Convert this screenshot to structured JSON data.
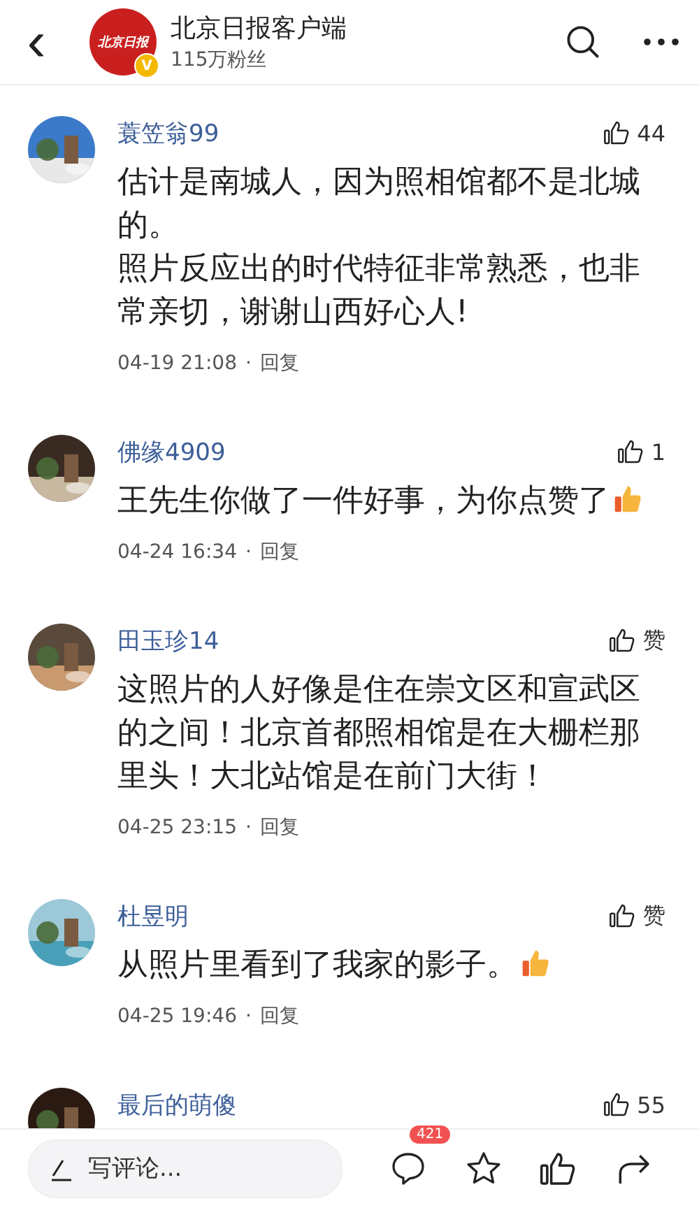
{
  "header": {
    "back": "‹",
    "logo_text": "北京日报",
    "verified": "V",
    "title": "北京日报客户端",
    "subtitle": "115万粉丝"
  },
  "comments": [
    {
      "name": "蓑笠翁99",
      "likes": "44",
      "paragraphs": [
        "估计是南城人，因为照相馆都不是北城的。",
        "照片反应出的时代特征非常熟悉，也非常亲切，谢谢山西好心人!"
      ],
      "emoji": false,
      "time": "04-19 21:08",
      "reply": "回复"
    },
    {
      "name": "佛缘4909",
      "likes": "1",
      "paragraphs": [
        "王先生你做了一件好事，为你点赞了"
      ],
      "emoji": true,
      "time": "04-24 16:34",
      "reply": "回复"
    },
    {
      "name": "田玉珍14",
      "likes": "赞",
      "paragraphs": [
        "这照片的人好像是住在崇文区和宣武区的之间！北京首都照相馆是在大栅栏那里头！大北站馆是在前门大街！"
      ],
      "emoji": false,
      "time": "04-25 23:15",
      "reply": "回复"
    },
    {
      "name": "杜昱明",
      "likes": "赞",
      "paragraphs": [
        "从照片里看到了我家的影子。"
      ],
      "emoji": true,
      "time": "04-25 19:46",
      "reply": "回复"
    },
    {
      "name": "最后的萌傻",
      "likes": "55",
      "emoji": false
    }
  ],
  "separator": "·",
  "bottom_bar": {
    "placeholder": "写评论...",
    "comment_count": "421"
  }
}
